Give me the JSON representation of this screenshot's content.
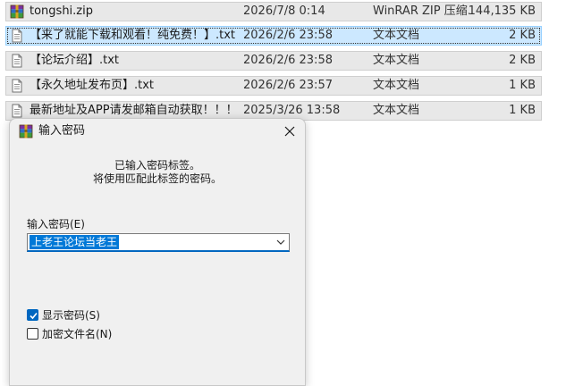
{
  "files": [
    {
      "name": "tongshi.zip",
      "date": "2026/7/8 0:14",
      "type": "WinRAR ZIP 压缩...",
      "size": "144,135 KB",
      "icon": "winrar-archive-icon",
      "selected": false
    },
    {
      "name": "【来了就能下载和观看！纯免费！】.txt",
      "date": "2026/2/6 23:58",
      "type": "文本文档",
      "size": "2 KB",
      "icon": "text-file-icon",
      "selected": true
    },
    {
      "name": "【论坛介绍】.txt",
      "date": "2026/2/6 23:58",
      "type": "文本文档",
      "size": "2 KB",
      "icon": "text-file-icon",
      "selected": false
    },
    {
      "name": "【永久地址发布页】.txt",
      "date": "2026/2/6 23:57",
      "type": "文本文档",
      "size": "1 KB",
      "icon": "text-file-icon",
      "selected": false
    },
    {
      "name": "最新地址及APP请发邮箱自动获取！！！....",
      "date": "2025/3/26 13:58",
      "type": "文本文档",
      "size": "1 KB",
      "icon": "text-file-icon",
      "selected": false
    }
  ],
  "dialog": {
    "title": "输入密码",
    "title_icon": "winrar-icon",
    "close_icon": "close-icon",
    "message_line1": "已输入密码标签。",
    "message_line2": "将使用匹配此标签的密码。",
    "password_label": "输入密码(E)",
    "password_value": "上老王论坛当老王",
    "show_password_label": "显示密码(S)",
    "show_password_checked": true,
    "encrypt_filenames_label": "加密文件名(N)",
    "encrypt_filenames_checked": false
  },
  "colors": {
    "selection": "#cce8ff",
    "accent": "#0067c0",
    "text_selection": "#0078d7"
  }
}
